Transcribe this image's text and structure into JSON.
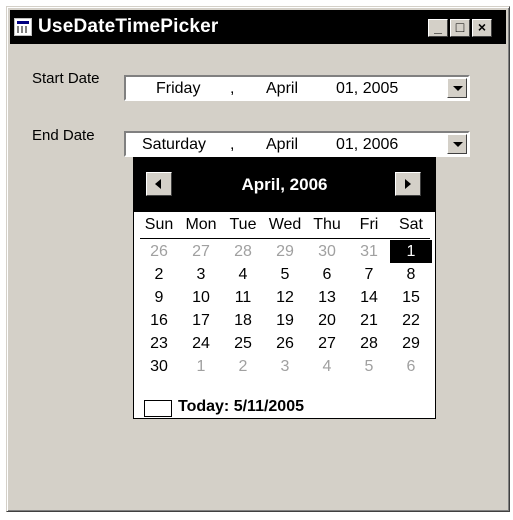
{
  "window": {
    "title": "UseDateTimePicker"
  },
  "titlebar_buttons": {
    "minimize": "_",
    "maximize": "□",
    "close": "×"
  },
  "form": {
    "start_label": "Start Date",
    "start_value": {
      "weekday": "Friday",
      "sep1": ",",
      "month": "April",
      "day_year": "01, 2005"
    },
    "end_label": "End Date",
    "end_value": {
      "weekday": "Saturday",
      "sep1": ",",
      "month": "April",
      "day_year": "01, 2006"
    }
  },
  "calendar": {
    "title": "April, 2006",
    "weekdays": [
      "Sun",
      "Mon",
      "Tue",
      "Wed",
      "Thu",
      "Fri",
      "Sat"
    ],
    "weeks": [
      [
        {
          "d": "26",
          "o": true
        },
        {
          "d": "27",
          "o": true
        },
        {
          "d": "28",
          "o": true
        },
        {
          "d": "29",
          "o": true
        },
        {
          "d": "30",
          "o": true
        },
        {
          "d": "31",
          "o": true
        },
        {
          "d": "1",
          "s": true
        }
      ],
      [
        {
          "d": "2"
        },
        {
          "d": "3"
        },
        {
          "d": "4"
        },
        {
          "d": "5"
        },
        {
          "d": "6"
        },
        {
          "d": "7"
        },
        {
          "d": "8"
        }
      ],
      [
        {
          "d": "9"
        },
        {
          "d": "10"
        },
        {
          "d": "11"
        },
        {
          "d": "12"
        },
        {
          "d": "13"
        },
        {
          "d": "14"
        },
        {
          "d": "15"
        }
      ],
      [
        {
          "d": "16"
        },
        {
          "d": "17"
        },
        {
          "d": "18"
        },
        {
          "d": "19"
        },
        {
          "d": "20"
        },
        {
          "d": "21"
        },
        {
          "d": "22"
        }
      ],
      [
        {
          "d": "23"
        },
        {
          "d": "24"
        },
        {
          "d": "25"
        },
        {
          "d": "26"
        },
        {
          "d": "27"
        },
        {
          "d": "28"
        },
        {
          "d": "29"
        }
      ],
      [
        {
          "d": "30"
        },
        {
          "d": "1",
          "o": true
        },
        {
          "d": "2",
          "o": true
        },
        {
          "d": "3",
          "o": true
        },
        {
          "d": "4",
          "o": true
        },
        {
          "d": "5",
          "o": true
        },
        {
          "d": "6",
          "o": true
        }
      ]
    ],
    "today_label": "Today: 5/11/2005"
  },
  "colors": {
    "face": "#d4d0c8",
    "title_bg": "#000000",
    "other_month": "#a0a0a0"
  },
  "icons": {
    "app": "form-icon",
    "prev": "left-arrow-icon",
    "next": "right-arrow-icon",
    "dropdown": "down-arrow-icon"
  }
}
